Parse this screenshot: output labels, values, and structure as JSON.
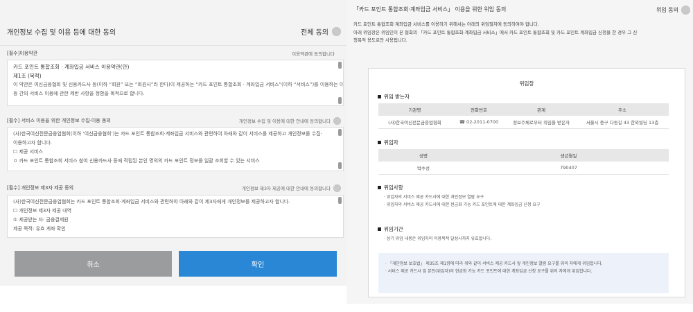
{
  "left": {
    "title": "개인정보 수집 및 이용 등에 대한 동의",
    "all_agree": "전체 동의",
    "sections": [
      {
        "header": "[필수]이용약관",
        "note": "이용약관에 동의합니다",
        "lines": [
          "카드 포인트 통합조회 · 계좌입금 서비스 이용약관(안)",
          "제1조 (목적)",
          "이 약관은 여신금융협회 및 신용카드사 등(이하 “회원” 또는 “회원사”라 한다)이 제공하는 “카드 포인트 통합조회 · 계좌입금 서비스”(이하 “서비스”)를 이용하는 이용자와 회원",
          "등 간의 서비스 이용에 관한 제반 사항을 정함을 목적으로 합니다."
        ]
      },
      {
        "header": "[필수] 서비스 이용을 위한 개인정보 수집·이용 동의",
        "note": "개인정보 수집 및 이용에 대한 안내에 동의합니다",
        "lines": [
          "(사)한국여신전문금융업협회(이하 ‘여신금융협회’)는 카드 포인트 통합조회·계좌입금 서비스와 관련하여 아래와 같이 서비스를 제공하고 개인정보를 수집·",
          "이용하고자 합니다.",
          "☐ 제공 서비스",
          "ㅇ 카드 포인트 통합조회 서비스 참여 신용카드사 등에 적립된 본인 명의의 카드 포인트 정보를 일괄 조회할 수 있는 서비스"
        ]
      },
      {
        "header": "[필수] 개인정보 제3자 제공 동의",
        "note": "개인정보 제3자 제공에 대한 안내에 동의합니다",
        "lines": [
          "(사)한국여신전문금융업협회는 카드 포인트 통합조회·계좌입금 서비스와 관련하여 아래와 같이 제3자에게 개인정보를 제공하고자 합니다.",
          "☐ 개인정보 제3자 제공 내역",
          "① 제공받는 자: 금융결제원",
          "제공 목적: 유효 계좌 확인"
        ]
      }
    ],
    "cancel_label": "취소",
    "ok_label": "확인"
  },
  "right": {
    "title": "「카드 포인트 통합조회·계좌입금 서비스」 이용을 위한 위임 동의",
    "consent_label": "위임 동의",
    "desc_lines": [
      "카드 포인트 통합조회·계좌입금 서비스를 이용하기 위해서는 아래의 위임절차에 동의하여야 합니다.",
      "아래 위임장은 위임인이 본 협회의 「카드 포인트 통합조회·계좌입금 서비스」에서 카드 포인트 통합조회 및 카드 포인트 계좌입금 신청을 한 경우 그 신",
      "청목적 용도로만 사용됩니다."
    ],
    "doc": {
      "title": "위임장",
      "agent_heading": "위임 받는자",
      "agent_headers": [
        "기관명",
        "전화번호",
        "관계",
        "주소"
      ],
      "agent_row": [
        "(사)한국여신전문금융업협회",
        "☎ 02-2011-0700",
        "정보주체로부터 위임을 받은자",
        "서울시 중구 다동길 43 한외빌딩 13층"
      ],
      "principal_heading": "위임자",
      "principal_headers": [
        "성명",
        "생년월일"
      ],
      "principal_row": [
        "박수성",
        "790407"
      ],
      "matters_heading": "위임사항",
      "matters": [
        "· 위임자의 서비스 제공 카드사에 대한 개인정보 열람 요구",
        "· 위임자의 서비스 제공 카드사에 대한 현금화 가능 카드 포인트에 대한 계좌입금 신청 요구"
      ],
      "period_heading": "위임기간",
      "period": "· 상기 위임 내용은 위임자의 이용목적 달성시까지 유효합니다.",
      "notes": [
        "· 「개인정보 보호법」 제35조 제1항에 따라 위와 같이 서비스 제공 카드사 앞 개인정보 열람 요구를 위의 자에게 위임합니다.",
        "· 서비스 제공 카드사 앞 본인(위임자)의 현금화 가능 카드 포인트에 대한 계좌입금 신청 요구를 위의 자에게 위임합니다."
      ]
    }
  },
  "colors": {
    "ok": "#2a87d6",
    "cancel": "#9a9c9e",
    "radio": "#c9c9c9"
  },
  "icons": [
    "radio-icon",
    "scrollbar-thumb"
  ]
}
